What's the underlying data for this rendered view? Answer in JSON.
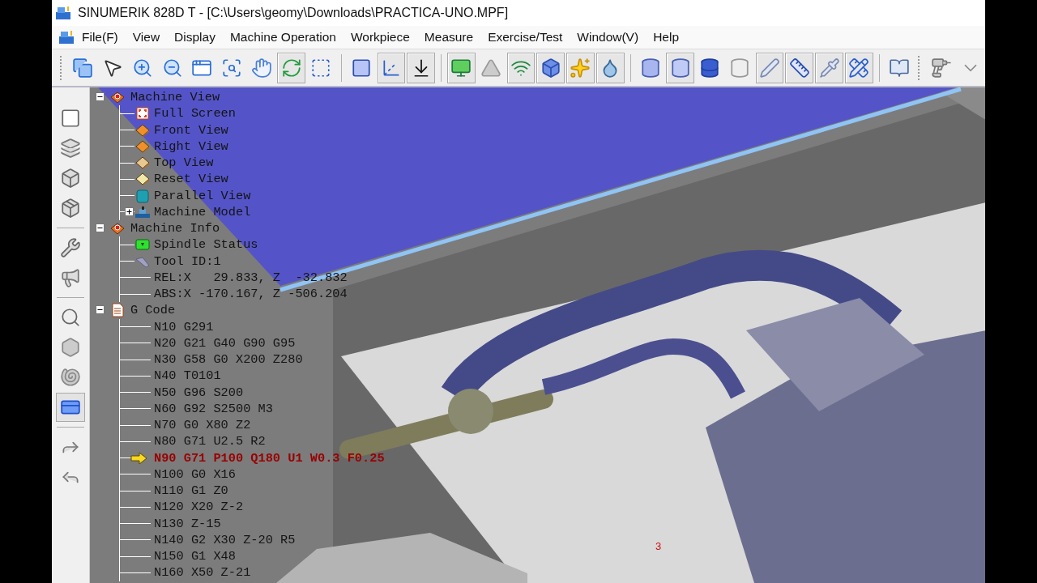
{
  "window": {
    "title": "SINUMERIK 828D T - [C:\\Users\\geomy\\Downloads\\PRACTICA-UNO.MPF]"
  },
  "menu": [
    "File(F)",
    "View",
    "Display",
    "Machine Operation",
    "Workpiece",
    "Measure",
    "Exercise/Test",
    "Window(V)",
    "Help"
  ],
  "toolbar": [
    {
      "kind": "grip"
    },
    {
      "kind": "windows",
      "pressed": false
    },
    {
      "kind": "pointer",
      "pressed": false
    },
    {
      "kind": "zoom-in",
      "pressed": false
    },
    {
      "kind": "zoom-out",
      "pressed": false
    },
    {
      "kind": "zoom-window",
      "pressed": false
    },
    {
      "kind": "zoom-fit",
      "pressed": false
    },
    {
      "kind": "hand",
      "pressed": false
    },
    {
      "kind": "rotate",
      "pressed": true
    },
    {
      "kind": "select-box",
      "pressed": false
    },
    {
      "kind": "separator"
    },
    {
      "kind": "rectangle",
      "pressed": false
    },
    {
      "kind": "axes",
      "pressed": true
    },
    {
      "kind": "dropdown",
      "pressed": true
    },
    {
      "kind": "separator"
    },
    {
      "kind": "monitor",
      "pressed": true
    },
    {
      "kind": "triangle",
      "pressed": false
    },
    {
      "kind": "signal",
      "pressed": true
    },
    {
      "kind": "cube",
      "pressed": true
    },
    {
      "kind": "stars",
      "pressed": true
    },
    {
      "kind": "faucet",
      "pressed": true
    },
    {
      "kind": "separator"
    },
    {
      "kind": "cylinder",
      "pressed": false
    },
    {
      "kind": "cylinder-step",
      "pressed": true
    },
    {
      "kind": "cylinder-open",
      "pressed": false
    },
    {
      "kind": "cylinder-clear",
      "pressed": false
    },
    {
      "kind": "tool-a",
      "pressed": true
    },
    {
      "kind": "tool-n",
      "pressed": true
    },
    {
      "kind": "tool-b",
      "pressed": true
    },
    {
      "kind": "tool-c",
      "pressed": true
    },
    {
      "kind": "separator"
    },
    {
      "kind": "book",
      "pressed": false
    },
    {
      "kind": "grip"
    },
    {
      "kind": "gun",
      "pressed": false
    },
    {
      "kind": "caret",
      "pressed": false
    }
  ],
  "side_toolbar": [
    {
      "kind": "window",
      "pressed": false
    },
    {
      "kind": "tray",
      "pressed": false
    },
    {
      "kind": "box-a",
      "pressed": false
    },
    {
      "kind": "box-b",
      "pressed": false
    },
    {
      "kind": "separator"
    },
    {
      "kind": "tools",
      "pressed": false
    },
    {
      "kind": "horn",
      "pressed": false
    },
    {
      "kind": "separator"
    },
    {
      "kind": "magnifier",
      "pressed": false
    },
    {
      "kind": "shape-a",
      "pressed": false
    },
    {
      "kind": "shape-b",
      "pressed": false
    },
    {
      "kind": "panel",
      "pressed": true
    },
    {
      "kind": "separator"
    },
    {
      "kind": "arrow-a",
      "pressed": false
    },
    {
      "kind": "arrow-b",
      "pressed": false
    }
  ],
  "tree": [
    {
      "label": "Machine View",
      "kind": "machine",
      "expanded": true,
      "children": [
        {
          "label": "Full Screen",
          "kind": "fullscreen"
        },
        {
          "label": "Front View",
          "kind": "view-orange"
        },
        {
          "label": "Right View",
          "kind": "view-orange"
        },
        {
          "label": "Top View",
          "kind": "view-tan"
        },
        {
          "label": "Reset View",
          "kind": "view-pale"
        },
        {
          "label": "Parallel View",
          "kind": "cyan-cube"
        },
        {
          "label": "Machine Model",
          "kind": "machine-model",
          "expanded": false
        }
      ]
    },
    {
      "label": "Machine Info",
      "kind": "machine",
      "expanded": true,
      "children": [
        {
          "label": "Spindle Status",
          "kind": "spindle"
        },
        {
          "label": "Tool ID:1",
          "kind": "tool"
        },
        {
          "label": "REL:X   29.833, Z  -32.832",
          "kind": "plain"
        },
        {
          "label": "ABS:X -170.167, Z -506.204",
          "kind": "plain"
        }
      ]
    },
    {
      "label": "G Code",
      "kind": "document",
      "expanded": true,
      "children": [
        {
          "label": "N10 G291",
          "kind": "code",
          "current": false
        },
        {
          "label": "N20 G21 G40 G90 G95",
          "kind": "code",
          "current": false
        },
        {
          "label": "N30 G58 G0 X200 Z280",
          "kind": "code",
          "current": false
        },
        {
          "label": "N40 T0101",
          "kind": "code",
          "current": false
        },
        {
          "label": "N50 G96 S200",
          "kind": "code",
          "current": false
        },
        {
          "label": "N60 G92 S2500 M3",
          "kind": "code",
          "current": false
        },
        {
          "label": "N70 G0 X80 Z2",
          "kind": "code",
          "current": false
        },
        {
          "label": "N80 G71 U2.5 R2",
          "kind": "code",
          "current": false
        },
        {
          "label": "N90 G71 P100 Q180 U1 W0.3 F0.25",
          "kind": "code",
          "current": true
        },
        {
          "label": "N100 G0 X16",
          "kind": "code",
          "current": false
        },
        {
          "label": "N110 G1 Z0",
          "kind": "code",
          "current": false
        },
        {
          "label": "N120 X20 Z-2",
          "kind": "code",
          "current": false
        },
        {
          "label": "N130 Z-15",
          "kind": "code",
          "current": false
        },
        {
          "label": "N140 G2 X30 Z-20 R5",
          "kind": "code",
          "current": false
        },
        {
          "label": "N150 G1 X48",
          "kind": "code",
          "current": false
        },
        {
          "label": "N160 X50 Z-21",
          "kind": "code",
          "current": false
        }
      ]
    }
  ],
  "scene_label": "3"
}
